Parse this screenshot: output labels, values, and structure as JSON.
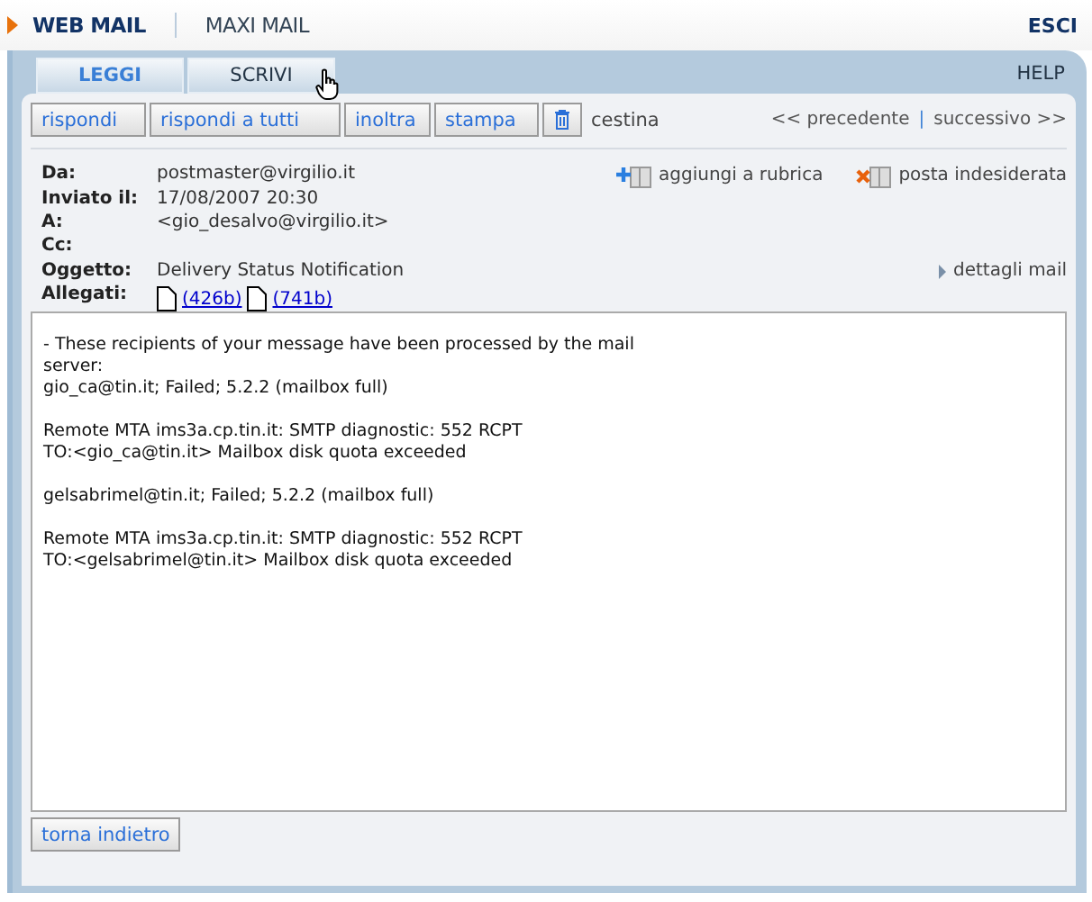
{
  "top_nav": [
    {
      "label": "WEB MAIL",
      "selected": true
    },
    {
      "label": "MAXI MAIL",
      "selected": false
    }
  ],
  "logout": "ESCI",
  "tabs": [
    {
      "label": "LEGGI",
      "selected": true
    },
    {
      "label": "SCRIVI",
      "selected": false
    }
  ],
  "help": "HELP",
  "toolbar": {
    "buttons": [
      "rispondi",
      "rispondi a tutti",
      "inoltra",
      "stampa"
    ],
    "trash": "cestina",
    "previous": "<< precedente",
    "separator": "|",
    "next": "successivo >>"
  },
  "header_fields": [
    {
      "label": "Da:",
      "value": "postmaster@virgilio.it"
    },
    {
      "label": "Inviato il:",
      "value": "17/08/2007 20:30"
    },
    {
      "label": "A:",
      "value": "<gio_desalvo@virgilio.it>"
    },
    {
      "label": "Cc:"
    },
    {
      "label": "Oggetto:",
      "value": "Delivery Status Notification"
    }
  ],
  "attachments_label": "Allegati:",
  "attachments": [
    "(426b)",
    "(741b)"
  ],
  "actions": [
    {
      "kind": "add",
      "label": "aggiungi a rubrica"
    },
    {
      "kind": "spam",
      "label": "posta indesiderata"
    }
  ],
  "details_link": "dettagli mail",
  "body_paragraphs": [
    [
      "- These recipients of your message have been processed by the mail",
      "server:",
      "gio_ca@tin.it; Failed; 5.2.2 (mailbox full)"
    ],
    [
      "Remote MTA ims3a.cp.tin.it: SMTP diagnostic: 552 RCPT",
      "TO:<gio_ca@tin.it> Mailbox disk quota exceeded"
    ],
    [
      "gelsabrimel@tin.it; Failed; 5.2.2 (mailbox full)"
    ],
    [
      "Remote MTA ims3a.cp.tin.it: SMTP diagnostic: 552 RCPT",
      "TO:<gelsabrimel@tin.it> Mailbox disk quota exceeded"
    ]
  ],
  "back_button": "torna indietro"
}
